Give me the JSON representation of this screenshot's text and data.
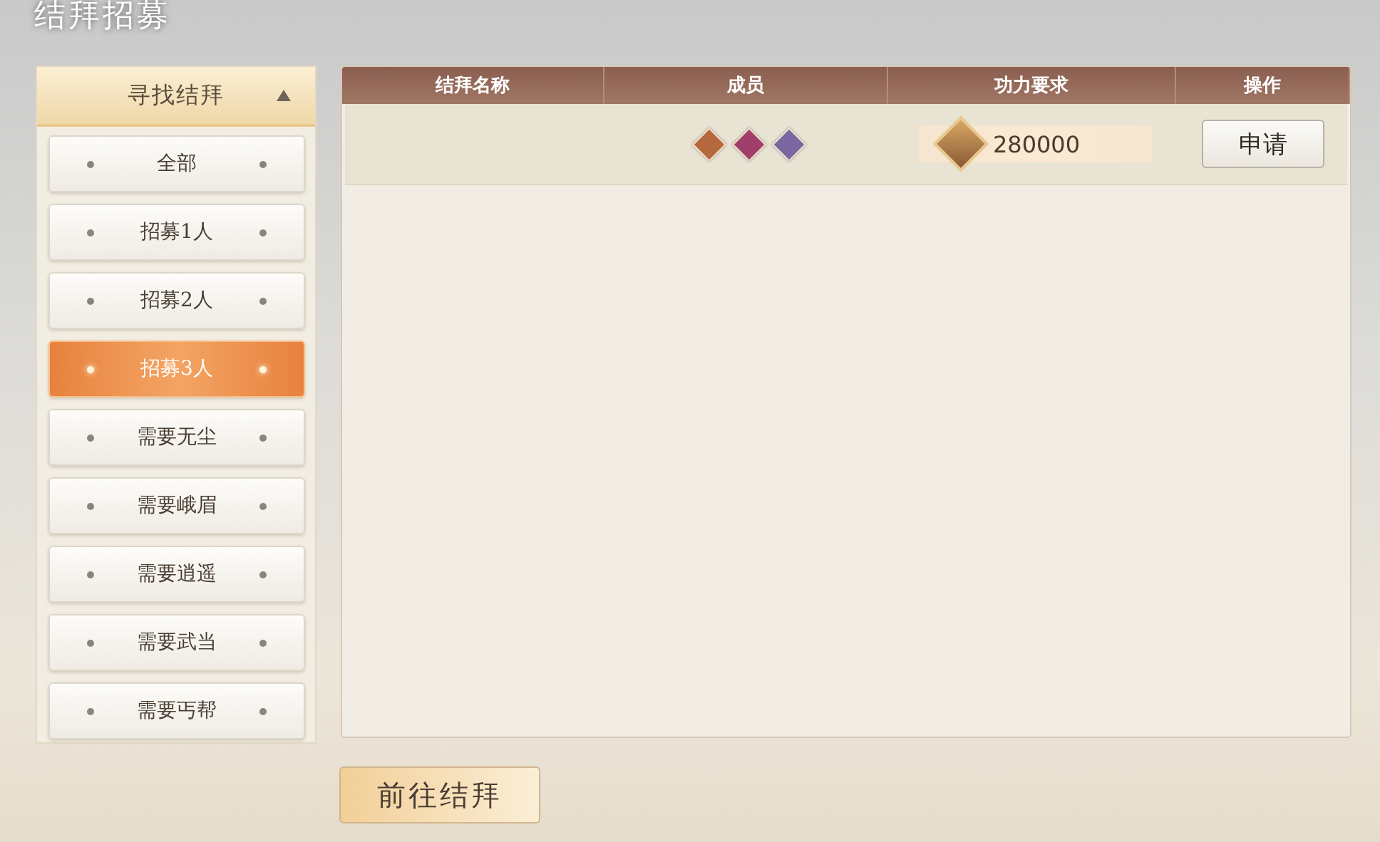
{
  "window": {
    "title": "结拜招募"
  },
  "filter": {
    "title": "寻找结拜",
    "expanded": true,
    "items": [
      {
        "label": "全部",
        "selected": false
      },
      {
        "label": "招募1人",
        "selected": false
      },
      {
        "label": "招募2人",
        "selected": false
      },
      {
        "label": "招募3人",
        "selected": true
      },
      {
        "label": "需要无尘",
        "selected": false
      },
      {
        "label": "需要峨眉",
        "selected": false
      },
      {
        "label": "需要逍遥",
        "selected": false
      },
      {
        "label": "需要武当",
        "selected": false
      },
      {
        "label": "需要丐帮",
        "selected": false
      }
    ]
  },
  "table": {
    "columns": [
      "结拜名称",
      "成员",
      "功力要求",
      "操作"
    ],
    "rows": [
      {
        "members": [
          {
            "color": "#b5673e"
          },
          {
            "color": "#a0406a"
          },
          {
            "color": "#7a66a0"
          }
        ],
        "power": "280000",
        "action": "申请"
      }
    ]
  },
  "footer_button": "前往结拜"
}
